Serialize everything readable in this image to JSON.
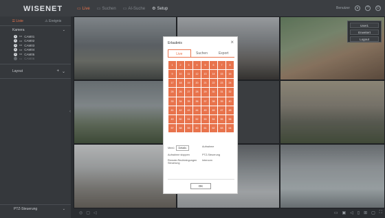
{
  "app": {
    "logo": "WISENET"
  },
  "nav": {
    "live": "Live",
    "search": "Suchen",
    "ai_search": "AI-Suche",
    "setup": "Setup"
  },
  "header_right": {
    "user": "Benutzer"
  },
  "sidebar": {
    "tabs": [
      "Liste",
      "Ereignis"
    ],
    "camera_section": "Kamera",
    "cameras": [
      {
        "num": "1",
        "name": "CAM01"
      },
      {
        "num": "2",
        "name": "CAM02"
      },
      {
        "num": "3",
        "name": "CAM03"
      },
      {
        "num": "4",
        "name": "CAM04"
      },
      {
        "num": "5",
        "name": "CAM05"
      },
      {
        "num": "",
        "name": "CAM06"
      }
    ],
    "layout_section": "Layout",
    "ptz_section": "PTZ-Steuerung"
  },
  "user_menu": {
    "items": [
      "User1",
      "Erweitert",
      "Logout"
    ]
  },
  "dialog": {
    "title": "Erlaubnis",
    "tabs": [
      "Live",
      "Suchen",
      "Export"
    ],
    "channels": [
      "1",
      "2",
      "3",
      "4",
      "5",
      "6",
      "7",
      "8",
      "9",
      "10",
      "11",
      "12",
      "13",
      "14",
      "15",
      "16",
      "17",
      "18",
      "19",
      "20",
      "21",
      "22",
      "23",
      "24",
      "25",
      "26",
      "27",
      "28",
      "29",
      "30",
      "31",
      "32",
      "33",
      "34",
      "35",
      "36",
      "37",
      "38",
      "39",
      "40",
      "41",
      "42",
      "43",
      "44",
      "45",
      "46",
      "47",
      "48",
      "49",
      "50",
      "51",
      "52",
      "53",
      "54",
      "55",
      "56",
      "57",
      "58",
      "59",
      "60",
      "61",
      "62",
      "63",
      "64"
    ],
    "menu_label": "Menü",
    "details_button": "Details",
    "perm_aufnahme": "Aufnahme",
    "perm_stoppen": "Aufnahme stoppen",
    "perm_ptz": "PTZ-Steuerung",
    "perm_remote": "Remote-Rechteingungen Steuerung",
    "perm_intercom": "Intercom",
    "ok_button": "OK"
  },
  "colors": {
    "accent": "#e8734c",
    "background": "#2a2d31"
  }
}
